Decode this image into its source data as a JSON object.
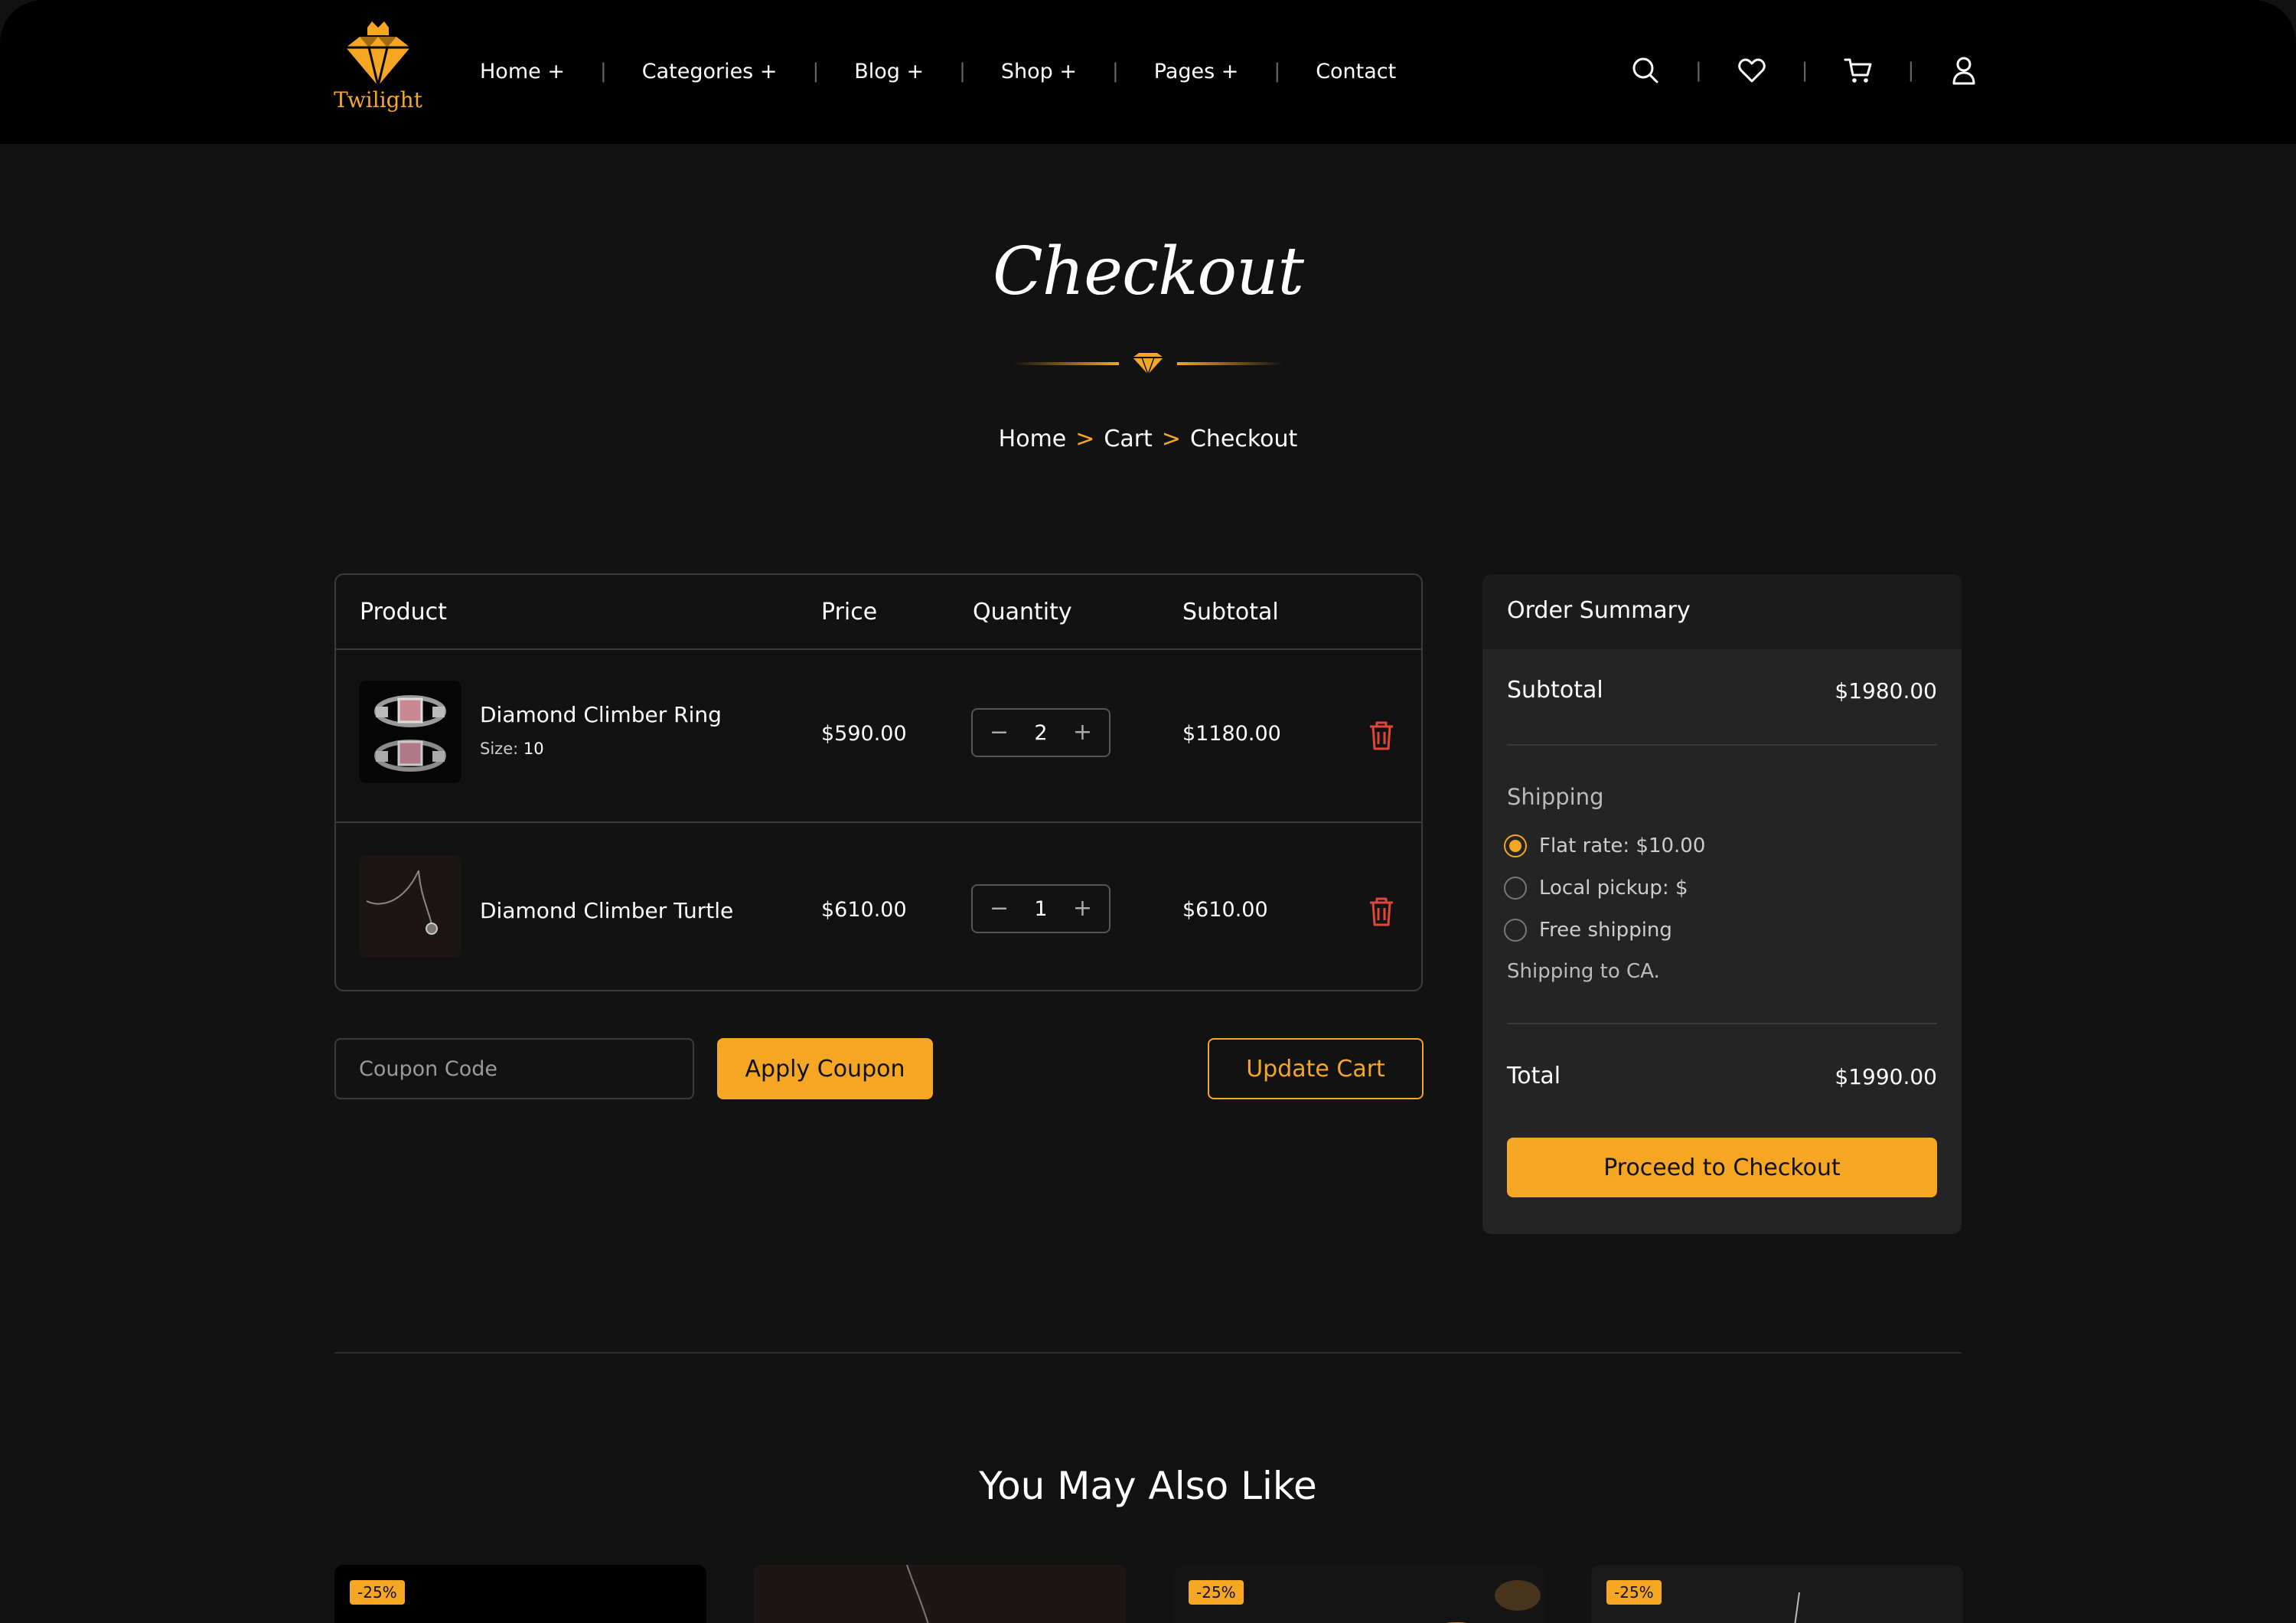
{
  "brand": {
    "name": "Twilight",
    "accent": "#f5a623"
  },
  "nav": {
    "items": [
      {
        "label": "Home +"
      },
      {
        "label": "Categories +"
      },
      {
        "label": "Blog +"
      },
      {
        "label": "Shop +"
      },
      {
        "label": "Pages +"
      },
      {
        "label": "Contact"
      }
    ],
    "separator": "|"
  },
  "header_icons": [
    "search-icon",
    "heart-icon",
    "cart-icon",
    "user-icon"
  ],
  "page": {
    "title": "Checkout",
    "breadcrumb": {
      "home": "Home",
      "cart": "Cart",
      "current": "Checkout",
      "separator": ">"
    }
  },
  "cart": {
    "headers": {
      "product": "Product",
      "price": "Price",
      "quantity": "Quantity",
      "subtotal": "Subtotal"
    },
    "items": [
      {
        "name": "Diamond Climber Ring",
        "size_label": "Size:",
        "size_value": "10",
        "price": "$590.00",
        "quantity": "2",
        "subtotal": "$1180.00",
        "minus": "−",
        "plus": "+"
      },
      {
        "name": "Diamond Climber Turtle",
        "price": "$610.00",
        "quantity": "1",
        "subtotal": "$610.00",
        "minus": "−",
        "plus": "+"
      }
    ]
  },
  "coupon": {
    "placeholder": "Coupon Code",
    "apply_label": "Apply Coupon",
    "update_label": "Update Cart"
  },
  "summary": {
    "title": "Order Summary",
    "subtotal_label": "Subtotal",
    "subtotal_value": "$1980.00",
    "shipping_title": "Shipping",
    "shipping_options": [
      {
        "label": "Flat rate: $10.00",
        "selected": true
      },
      {
        "label": "Local pickup: $",
        "selected": false
      },
      {
        "label": "Free shipping",
        "selected": false
      }
    ],
    "shipping_to": "Shipping to CA.",
    "total_label": "Total",
    "total_value": "$1990.00",
    "checkout_label": "Proceed to Checkout"
  },
  "related": {
    "title": "You May Also Like",
    "cards": [
      {
        "badge": "-25%"
      },
      {
        "badge": ""
      },
      {
        "badge": "-25%"
      },
      {
        "badge": "-25%"
      }
    ]
  }
}
